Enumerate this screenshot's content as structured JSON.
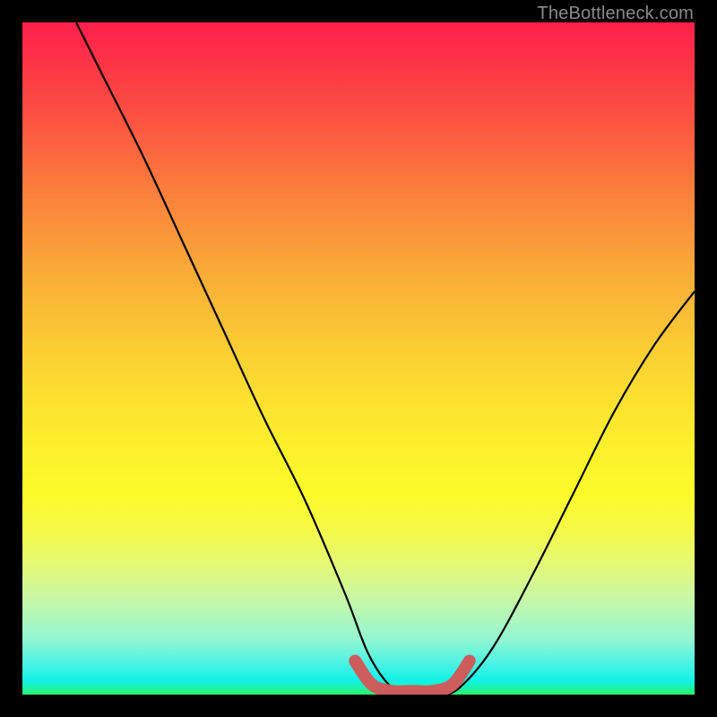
{
  "watermark": {
    "text": "TheBottleneck.com"
  },
  "chart_data": {
    "type": "line",
    "title": "",
    "xlabel": "",
    "ylabel": "",
    "xlim": [
      0,
      100
    ],
    "ylim": [
      0,
      100
    ],
    "grid": false,
    "legend": false,
    "background_gradient_stops": [
      {
        "pos": 0,
        "color": "#ff1f4b"
      },
      {
        "pos": 25,
        "color": "#fb823c"
      },
      {
        "pos": 50,
        "color": "#fbd232"
      },
      {
        "pos": 70,
        "color": "#fcfb29"
      },
      {
        "pos": 90,
        "color": "#90f6d4"
      },
      {
        "pos": 100,
        "color": "#2cf568"
      }
    ],
    "series": [
      {
        "name": "bottleneck-curve",
        "color": "#000000",
        "x": [
          8,
          12,
          18,
          24,
          30,
          36,
          42,
          48,
          51.5,
          55,
          58,
          62,
          65,
          70,
          76,
          82,
          88,
          94,
          100
        ],
        "values": [
          100,
          92,
          80,
          67,
          54,
          41,
          29,
          15,
          6,
          1,
          0,
          0,
          1,
          7,
          18,
          30,
          42,
          52,
          60
        ]
      },
      {
        "name": "optimal-zone-accent",
        "color": "#cd5c5c",
        "x": [
          49.5,
          52,
          55,
          58,
          61,
          64,
          66.5
        ],
        "values": [
          5,
          1.5,
          0.5,
          0.5,
          0.5,
          1.5,
          5
        ]
      }
    ],
    "notes": "V-shaped bottleneck curve over a rainbow gradient. Values approximate; no axis ticks shown in source."
  }
}
